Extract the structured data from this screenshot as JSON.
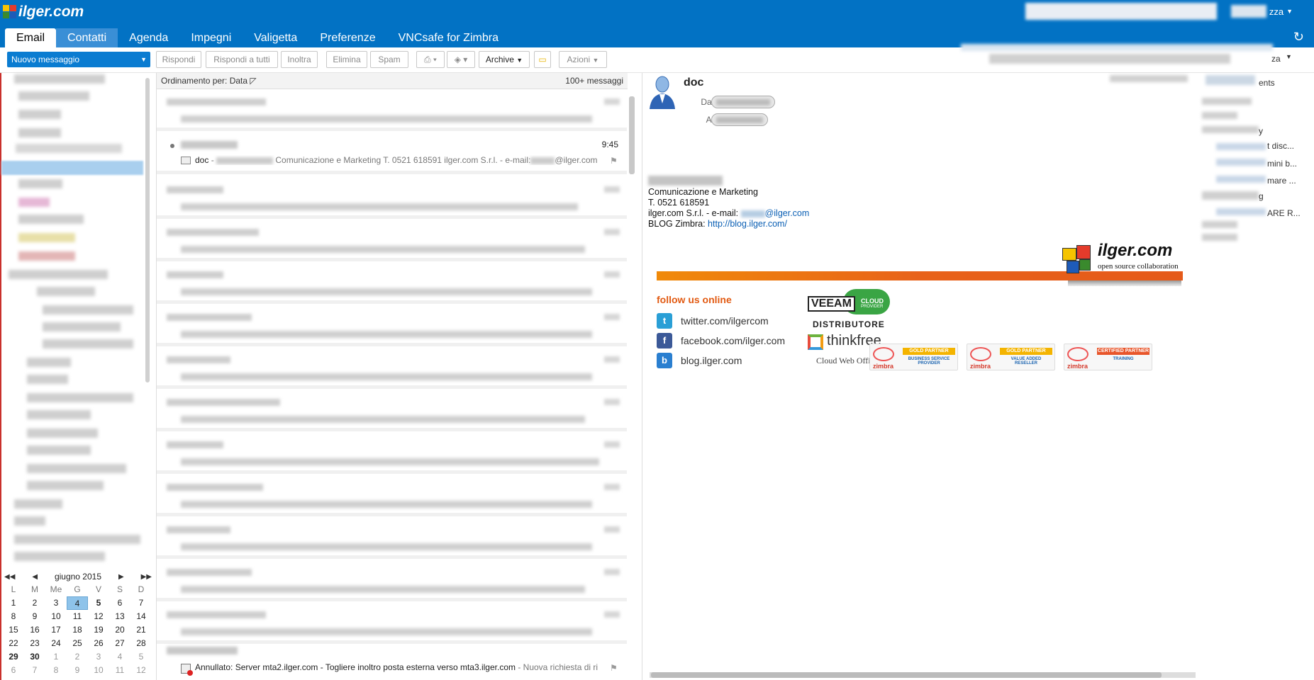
{
  "header": {
    "logo_text": "ilger.com",
    "user_suffix": "zza",
    "refresh_symbol": "↻"
  },
  "tabs": [
    {
      "label": "Email"
    },
    {
      "label": "Contatti"
    },
    {
      "label": "Agenda"
    },
    {
      "label": "Impegni"
    },
    {
      "label": "Valigetta"
    },
    {
      "label": "Preferenze"
    },
    {
      "label": "VNCsafe for Zimbra"
    }
  ],
  "toolbar": {
    "new_message": "Nuovo messaggio",
    "reply": "Rispondi",
    "reply_all": "Rispondi a tutti",
    "forward": "Inoltra",
    "delete": "Elimina",
    "spam": "Spam",
    "archive": "Archive",
    "actions": "Azioni"
  },
  "list": {
    "sort_label": "Ordinamento per: Data",
    "count": "100+ messaggi",
    "selected": {
      "time": "9:45",
      "subject": "doc",
      "separator": " - ",
      "preview": "Comunicazione e Marketing T. 0521 618591 ilger.com S.r.l. - e-mail:",
      "preview_tail": "@ilger.com"
    },
    "last": {
      "subject": "Annullato: Server mta2.ilger.com - Togliere inoltro posta esterna verso mta3.ilger.com",
      "preview": " - Nuova richiesta di ri"
    }
  },
  "calendar": {
    "month": "giugno 2015",
    "days": [
      "L",
      "M",
      "Me",
      "G",
      "V",
      "S",
      "D"
    ],
    "weeks": [
      [
        "1",
        "2",
        "3",
        "4",
        "5",
        "6",
        "7"
      ],
      [
        "8",
        "9",
        "10",
        "11",
        "12",
        "13",
        "14"
      ],
      [
        "15",
        "16",
        "17",
        "18",
        "19",
        "20",
        "21"
      ],
      [
        "22",
        "23",
        "24",
        "25",
        "26",
        "27",
        "28"
      ],
      [
        "29",
        "30",
        "1",
        "2",
        "3",
        "4",
        "5"
      ],
      [
        "6",
        "7",
        "8",
        "9",
        "10",
        "11",
        "12"
      ]
    ],
    "today": "4"
  },
  "reading": {
    "subject": "doc",
    "from_label": "Da:",
    "to_label": "A:",
    "sig_line1": "Comunicazione e Marketing",
    "sig_line2": "T. 0521 618591",
    "sig_line3": "ilger.com S.r.l. - e-mail: ",
    "sig_email_tail": "@ilger.com",
    "sig_line4": "BLOG Zimbra: ",
    "blog_link": "http://blog.ilger.com/",
    "brand_name": "ilger.com",
    "brand_tagline": "open source collaboration",
    "follow": "follow us online",
    "social": [
      {
        "text": "twitter.com/ilgercom",
        "icon": "twitter-icon",
        "color": "#2a9fd6"
      },
      {
        "text": "facebook.com/ilger.com",
        "icon": "facebook-icon",
        "color": "#3b5998"
      },
      {
        "text": "blog.ilger.com",
        "icon": "blog-icon",
        "color": "#2a7fd0"
      }
    ],
    "veeam": "VEEAM",
    "veeam_cloud": "CLOUD",
    "veeam_provider": "PROVIDER",
    "distributore": "DISTRIBUTORE",
    "thinkfree": "thinkfree",
    "thinkfree_sub": "Cloud Web Office",
    "badges": [
      {
        "zimbra": "zimbra",
        "top": "GOLD PARTNER",
        "sub": "BUSINESS SERVICE PROVIDER"
      },
      {
        "zimbra": "zimbra",
        "top": "GOLD PARTNER",
        "sub": "VALUE ADDED RESELLER"
      },
      {
        "zimbra": "zimbra",
        "top": "CERTIFIED PARTNER",
        "sub": "TRAINING"
      }
    ]
  },
  "right_panel": {
    "t1": "za",
    "t2": "ents",
    "t3": "y",
    "t4": "t disc...",
    "t5": "mini b...",
    "t6": "mare ...",
    "t7": "g",
    "t8": "ARE R..."
  },
  "colors": {
    "brand": "#0272c4",
    "accent": "#e25a12"
  }
}
